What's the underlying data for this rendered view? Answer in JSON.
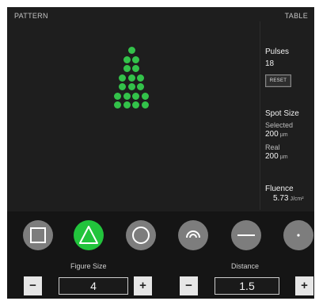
{
  "header": {
    "left_title": "PATTERN",
    "right_title": "TABLE"
  },
  "pattern": {
    "shape": "triangle",
    "dot_color": "#33c24a",
    "rows": [
      1,
      2,
      2,
      3,
      3,
      4,
      4
    ]
  },
  "side_panel": {
    "pulses_label": "Pulses",
    "pulses_value": "18",
    "reset_label": "RESET",
    "spot_size_label": "Spot Size",
    "selected_label": "Selected",
    "selected_value": "200",
    "selected_unit": "µm",
    "real_label": "Real",
    "real_value": "200",
    "real_unit": "µm",
    "fluence_label": "Fluence",
    "fluence_value": "5.73",
    "fluence_unit": "J/cm²"
  },
  "figures": [
    {
      "name": "square",
      "icon": "square-icon",
      "active": false
    },
    {
      "name": "triangle",
      "icon": "triangle-icon",
      "active": true
    },
    {
      "name": "circle",
      "icon": "circle-icon",
      "active": false
    },
    {
      "name": "arc",
      "icon": "arc-icon",
      "active": false
    },
    {
      "name": "line",
      "icon": "line-icon",
      "active": false
    },
    {
      "name": "dot",
      "icon": "dot-icon",
      "active": false
    }
  ],
  "figure_size": {
    "label": "Figure Size",
    "value": "4",
    "minus": "−",
    "plus": "+"
  },
  "distance": {
    "label": "Distance",
    "value": "1.5",
    "minus": "−",
    "plus": "+"
  },
  "colors": {
    "accent": "#22c43c",
    "background": "#1e1e1e",
    "inactive_figure": "#7d7d7d"
  }
}
